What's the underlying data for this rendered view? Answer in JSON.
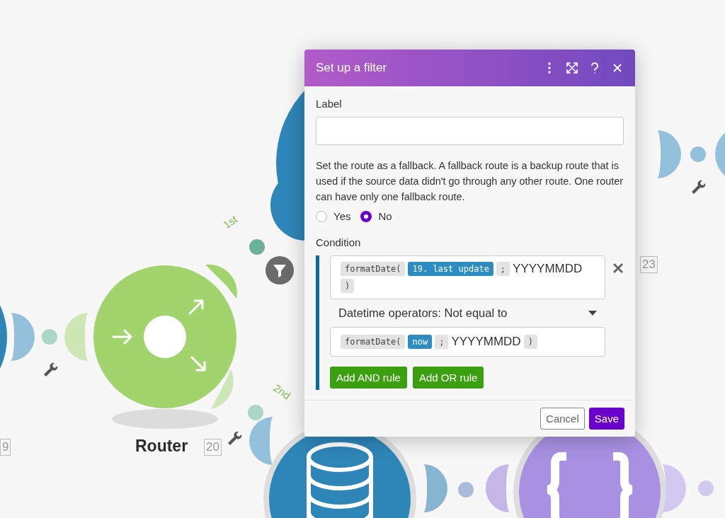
{
  "canvas": {
    "modules": [
      {
        "kind": "partial-blue",
        "number": "9"
      },
      {
        "kind": "router",
        "label": "Router",
        "number": "20"
      },
      {
        "kind": "top-blue",
        "number": "23"
      },
      {
        "kind": "database"
      },
      {
        "kind": "json"
      }
    ],
    "routes": [
      {
        "label": "1st",
        "filter": true
      },
      {
        "label": "2nd",
        "filter": false
      }
    ]
  },
  "dialog": {
    "title": "Set up a filter",
    "label_field": {
      "label": "Label"
    },
    "fallback": {
      "description": "Set the route as a fallback. A fallback route is a backup route that is used if the source data didn't go through any other route. One router can have only one fallback route.",
      "options": [
        {
          "label": "Yes",
          "selected": false
        },
        {
          "label": "No",
          "selected": true
        }
      ]
    },
    "condition": {
      "label": "Condition",
      "rules": [
        {
          "left": [
            {
              "kind": "function",
              "text": "formatDate("
            },
            {
              "kind": "variable",
              "text": "19. last update"
            },
            {
              "kind": "separator",
              "text": ";"
            },
            {
              "kind": "text",
              "text": "YYYYMMDD"
            },
            {
              "kind": "function",
              "text": ")"
            }
          ],
          "operator": "Datetime operators: Not equal to",
          "right": [
            {
              "kind": "function",
              "text": "formatDate("
            },
            {
              "kind": "variable",
              "text": "now"
            },
            {
              "kind": "separator",
              "text": ";"
            },
            {
              "kind": "text",
              "text": "YYYYMMDD"
            },
            {
              "kind": "function",
              "text": ")"
            }
          ]
        }
      ],
      "buttons": [
        "Add AND rule",
        "Add OR rule"
      ]
    },
    "footer": [
      {
        "label": "Cancel",
        "kind": "secondary"
      },
      {
        "label": "Save",
        "kind": "primary"
      }
    ]
  }
}
